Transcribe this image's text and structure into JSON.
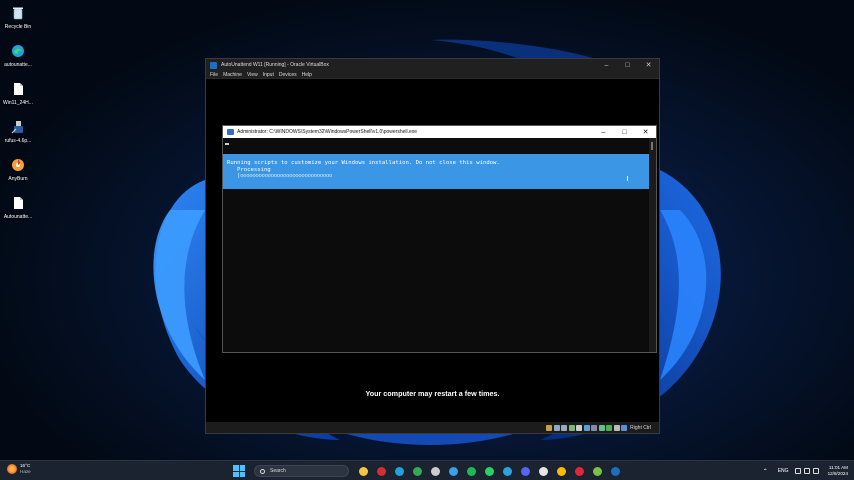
{
  "desktop": {
    "icons": [
      {
        "label": "Recycle Bin",
        "icon": "recycle-bin-icon"
      },
      {
        "label": "autounatte...",
        "icon": "edge-icon"
      },
      {
        "label": "Win11_24H...",
        "icon": "file-icon"
      },
      {
        "label": "rufus-4.6p...",
        "icon": "usb-icon"
      },
      {
        "label": "AnyBurn",
        "icon": "anyburn-icon"
      },
      {
        "label": "Autounatte...",
        "icon": "file-icon"
      }
    ]
  },
  "virtualbox": {
    "title": "AutoUnattend W11 [Running] - Oracle VirtualBox",
    "menu": [
      "File",
      "Machine",
      "View",
      "Input",
      "Devices",
      "Help"
    ],
    "status_host_key": "Right Ctrl",
    "restart_message": "Your computer may restart a few times."
  },
  "powershell": {
    "title": "Administrator: C:\\WINDOWS\\System32\\WindowsPowerShell\\v1.0\\powershell.exe",
    "progress_line1": "Running scripts to customize your Windows installation. Do not close this window.",
    "progress_line2": "Processing",
    "progress_line3": "[oooooooooooooooooooooooooooooo"
  },
  "taskbar": {
    "weather_temp": "16°C",
    "weather_cond": "Haze",
    "search_placeholder": "Search",
    "lang": "ENG",
    "time": "11:01 AM",
    "date": "12/8/2024",
    "apps": [
      {
        "icon": "file-explorer-icon",
        "color": "#f4c542"
      },
      {
        "icon": "flash-app-icon",
        "color": "#d22f2f"
      },
      {
        "icon": "edge-icon",
        "color": "#1fa3d8"
      },
      {
        "icon": "chrome-icon",
        "color": "#34a853"
      },
      {
        "icon": "capture-app-icon",
        "color": "#cccccc"
      },
      {
        "icon": "photos-icon",
        "color": "#3aa0e8"
      },
      {
        "icon": "spotify-icon",
        "color": "#1db954"
      },
      {
        "icon": "whatsapp-icon",
        "color": "#25d366"
      },
      {
        "icon": "telegram-icon",
        "color": "#2aa3e0"
      },
      {
        "icon": "discord-icon",
        "color": "#5865f2"
      },
      {
        "icon": "capcut-icon",
        "color": "#e6e6e6"
      },
      {
        "icon": "chrome-alt-icon",
        "color": "#fbbc05"
      },
      {
        "icon": "opera-icon",
        "color": "#e3263b"
      },
      {
        "icon": "android-app-icon",
        "color": "#7bc144"
      },
      {
        "icon": "virtualbox-icon",
        "color": "#1a6fc2"
      }
    ]
  }
}
